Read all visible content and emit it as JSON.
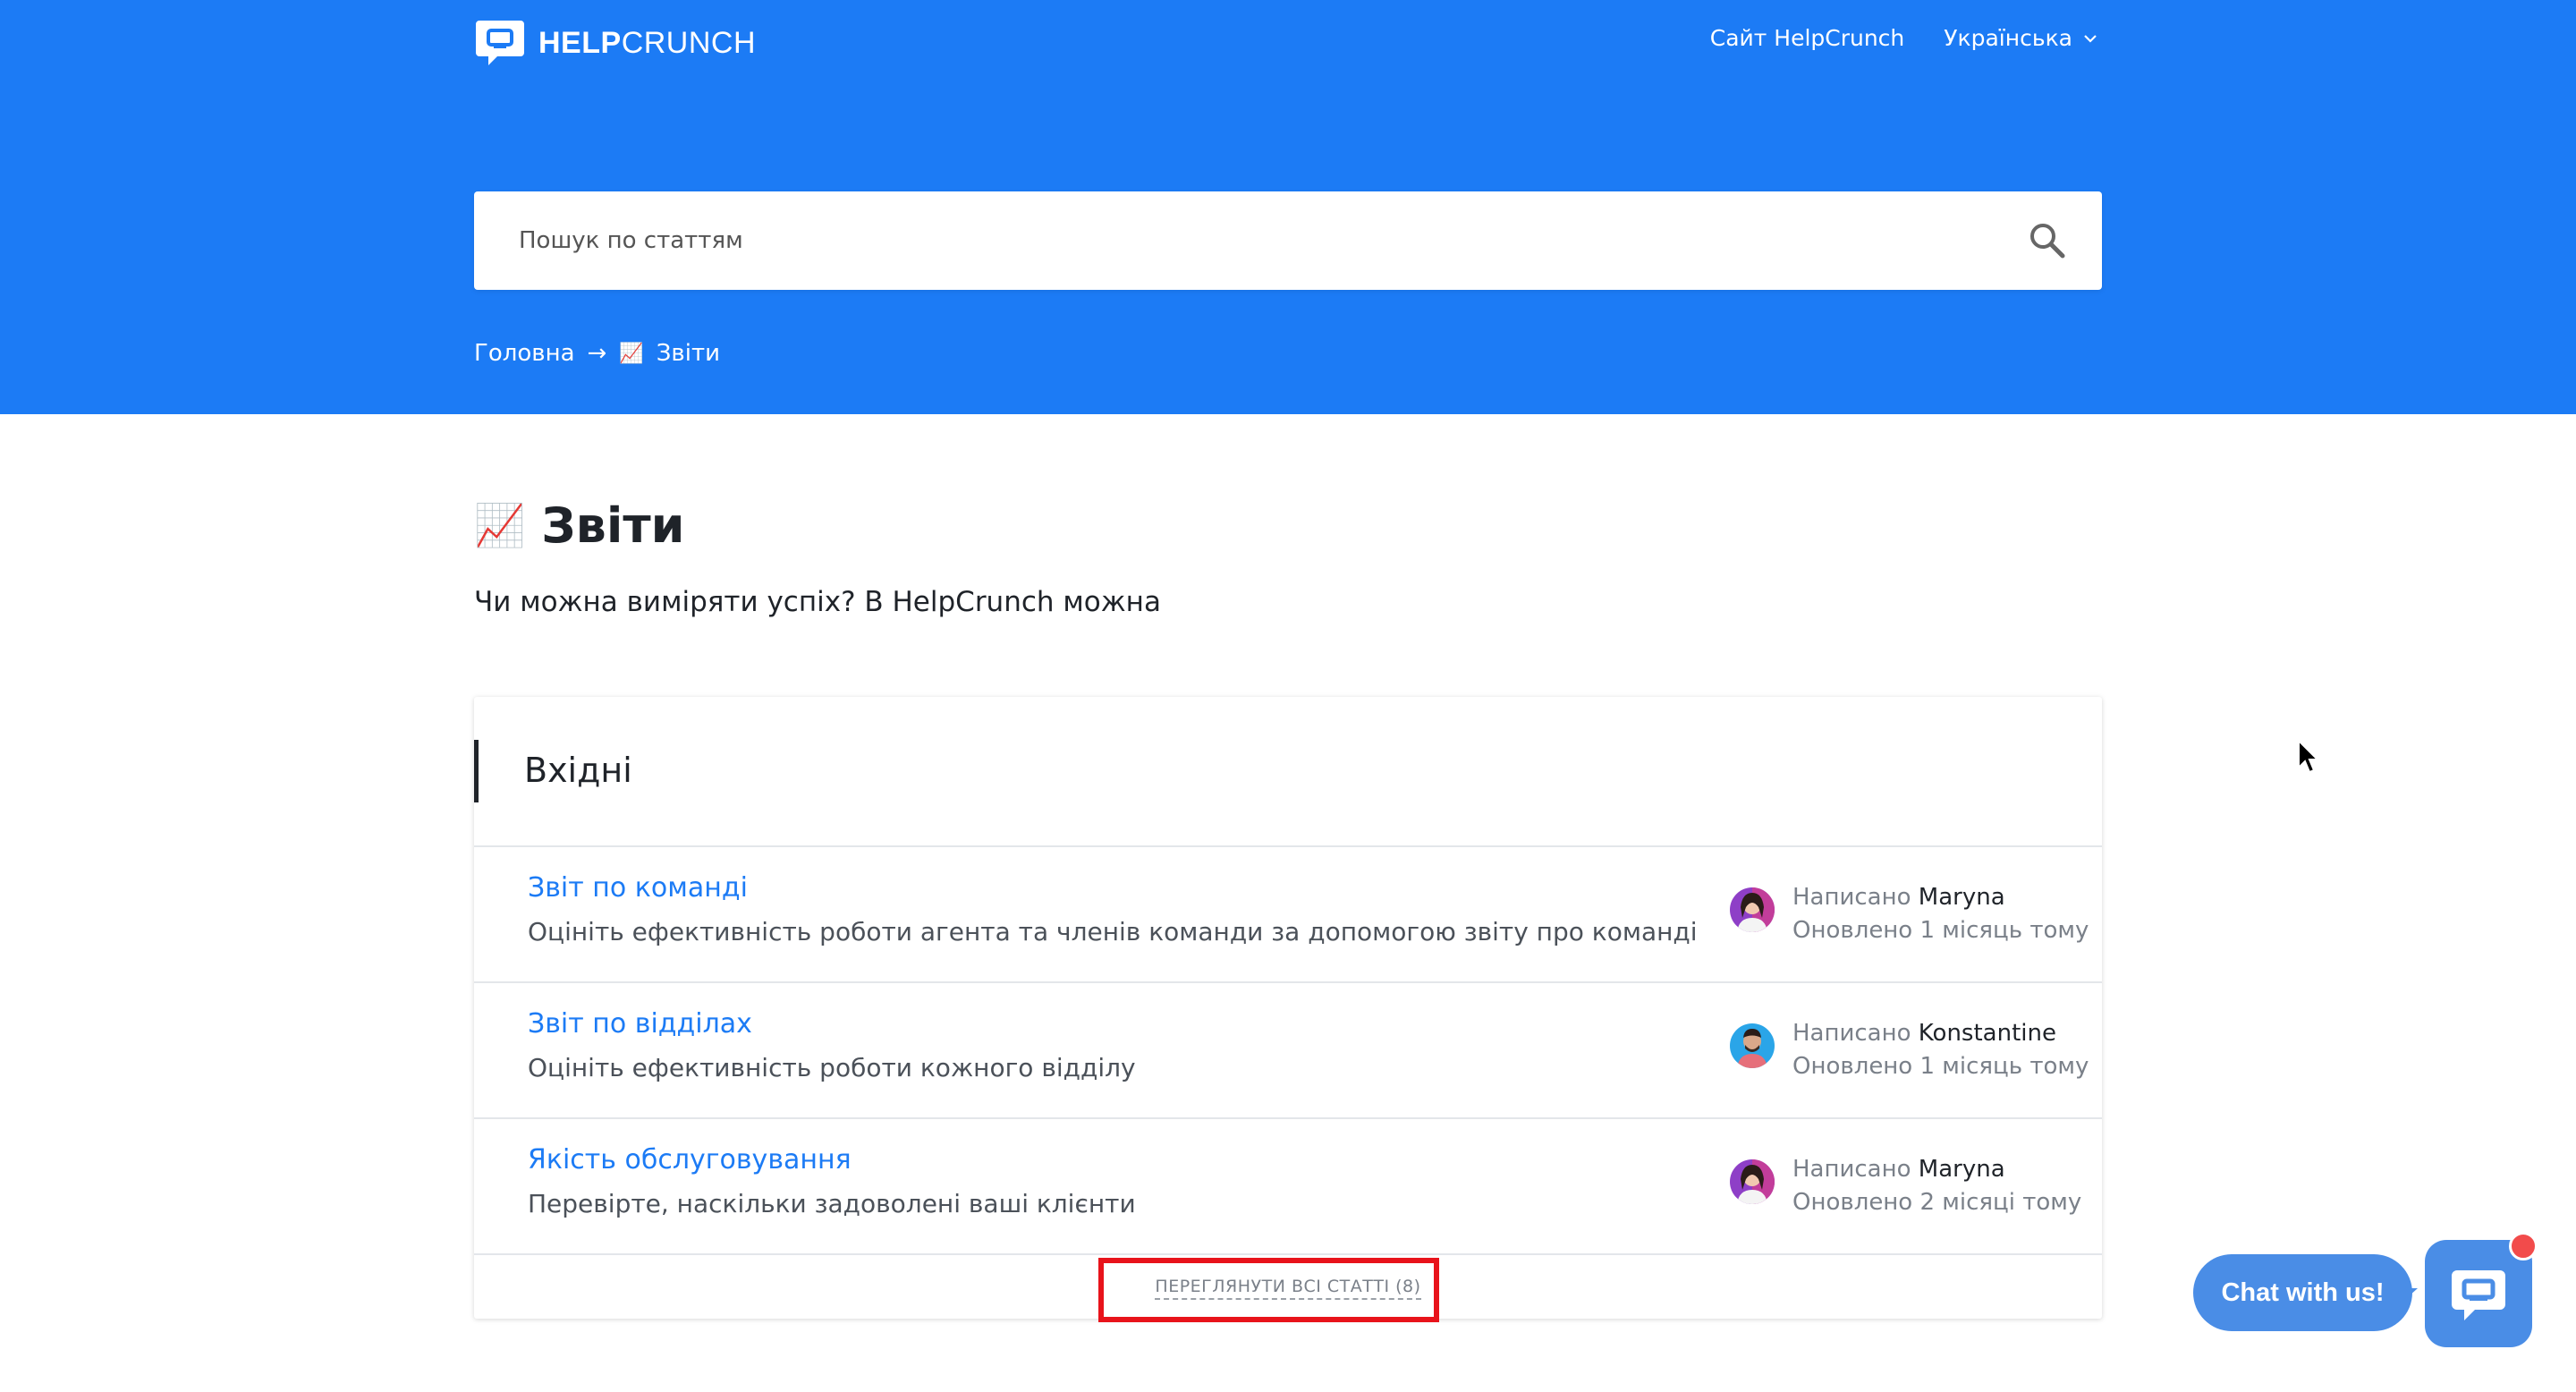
{
  "header": {
    "logo_bold": "HELP",
    "logo_light": "CRUNCH",
    "site_link": "Сайт HelpCrunch",
    "language": "Українська"
  },
  "search": {
    "placeholder": "Пошук по статтям"
  },
  "breadcrumb": {
    "home": "Головна",
    "separator": "→",
    "current_emoji": "📈",
    "current": "Звіти"
  },
  "page": {
    "emoji": "📈",
    "title": "Звіти",
    "description": "Чи можна виміряти успіх? В HelpCrunch можна"
  },
  "section": {
    "title": "Вхідні",
    "articles": [
      {
        "title": "Звіт по команді",
        "description": "Оцініть ефективність роботи агента та членів команди за допомогою звіту про команді",
        "written_label": "Написано",
        "author": "Maryna",
        "updated": "Оновлено 1 місяць тому"
      },
      {
        "title": "Звіт по відділах",
        "description": "Оцініть ефективність роботи кожного відділу",
        "written_label": "Написано",
        "author": "Konstantine",
        "updated": "Оновлено 1 місяць тому"
      },
      {
        "title": "Якість обслуговування",
        "description": "Перевірте, наскільки задоволені ваші клієнти",
        "written_label": "Написано",
        "author": "Maryna",
        "updated": "Оновлено 2 місяці тому"
      }
    ],
    "view_all": "ПЕРЕГЛЯНУТИ ВСІ СТАТТІ (8)"
  },
  "chat": {
    "label": "Chat with us!"
  },
  "colors": {
    "brand": "#1c7bf5",
    "chat": "#4a8de6",
    "highlight": "#e8131b"
  }
}
